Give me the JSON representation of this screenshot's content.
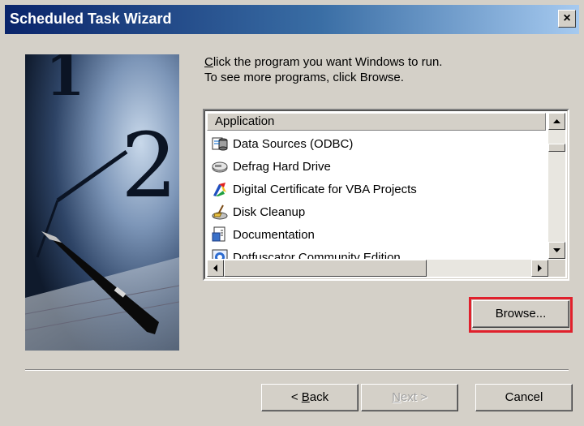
{
  "window": {
    "title": "Scheduled Task Wizard",
    "close_label": "×"
  },
  "instructions": {
    "line1_accel": "C",
    "line1_rest": "lick the program you want Windows to run.",
    "line2": "To see more programs, click Browse."
  },
  "list": {
    "column_header": "Application",
    "items": [
      {
        "label": "Data Sources (ODBC)",
        "icon": "data-sources-icon"
      },
      {
        "label": "Defrag Hard Drive",
        "icon": "defrag-icon"
      },
      {
        "label": "Digital Certificate for VBA Projects",
        "icon": "certificate-icon"
      },
      {
        "label": "Disk Cleanup",
        "icon": "disk-cleanup-icon"
      },
      {
        "label": "Documentation",
        "icon": "documentation-icon"
      },
      {
        "label": "Dotfuscator Community Edition",
        "icon": "dotfuscator-icon"
      }
    ]
  },
  "buttons": {
    "browse": "Browse...",
    "back_accel": "B",
    "back_prefix": "< ",
    "back_rest": "ack",
    "next_accel": "N",
    "next_rest": "ext >",
    "cancel": "Cancel"
  },
  "colors": {
    "title_start": "#0a246a",
    "title_end": "#a6caf0",
    "face": "#d4d0c8",
    "highlight_border": "#e0202c"
  }
}
